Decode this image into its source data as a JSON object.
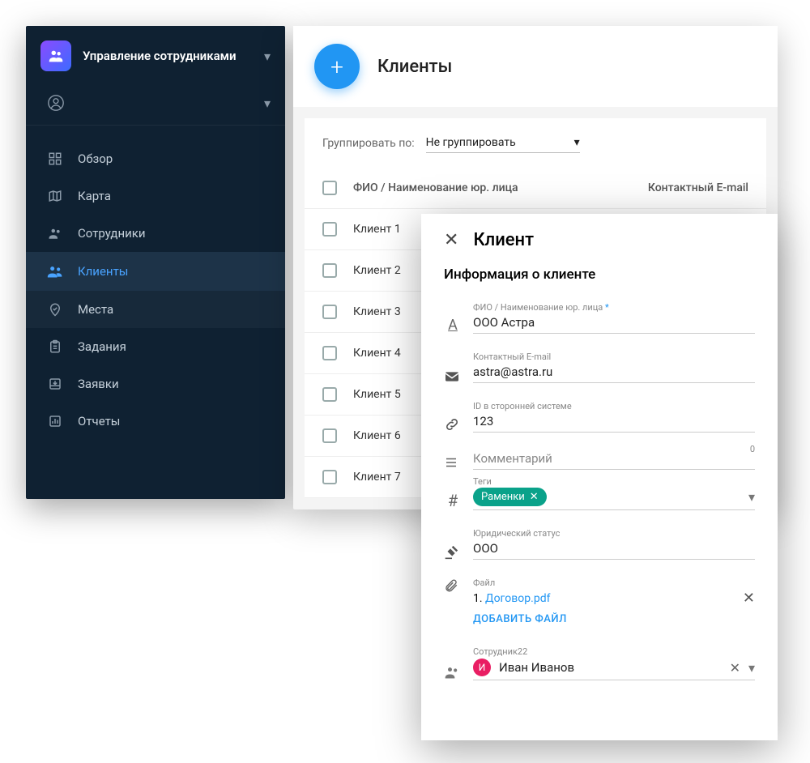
{
  "sidebar": {
    "app_title": "Управление сотрудниками",
    "nav": [
      {
        "label": "Обзор"
      },
      {
        "label": "Карта"
      },
      {
        "label": "Сотрудники"
      },
      {
        "label": "Клиенты"
      },
      {
        "label": "Места"
      },
      {
        "label": "Задания"
      },
      {
        "label": "Заявки"
      },
      {
        "label": "Отчеты"
      }
    ]
  },
  "main": {
    "title": "Клиенты",
    "group_label": "Группировать по:",
    "group_value": "Не группировать",
    "col_name": "ФИО / Наименование юр. лица",
    "col_email": "Контактный E-mail",
    "rows": [
      {
        "name": "Клиент 1"
      },
      {
        "name": "Клиент 2"
      },
      {
        "name": "Клиент 3"
      },
      {
        "name": "Клиент 4"
      },
      {
        "name": "Клиент 5"
      },
      {
        "name": "Клиент 6"
      },
      {
        "name": "Клиент 7"
      }
    ]
  },
  "detail": {
    "title": "Клиент",
    "subtitle": "Информация о клиенте",
    "name_label": "ФИО / Наименование юр. лица",
    "name_value": "ООО Астра",
    "email_label": "Контактный E-mail",
    "email_value": "astra@astra.ru",
    "ext_id_label": "ID в сторонней системе",
    "ext_id_value": "123",
    "comment_placeholder": "Комментарий",
    "comment_counter": "0",
    "tags_label": "Теги",
    "tag_value": "Раменки",
    "legal_label": "Юридический статус",
    "legal_value": "ООО",
    "file_label": "Файл",
    "file_item_prefix": "1.",
    "file_item_name": "Договор.pdf",
    "add_file_label": "ДОБАВИТЬ ФАЙЛ",
    "employee_label": "Сотрудник22",
    "employee_initial": "И",
    "employee_name": "Иван Иванов"
  }
}
